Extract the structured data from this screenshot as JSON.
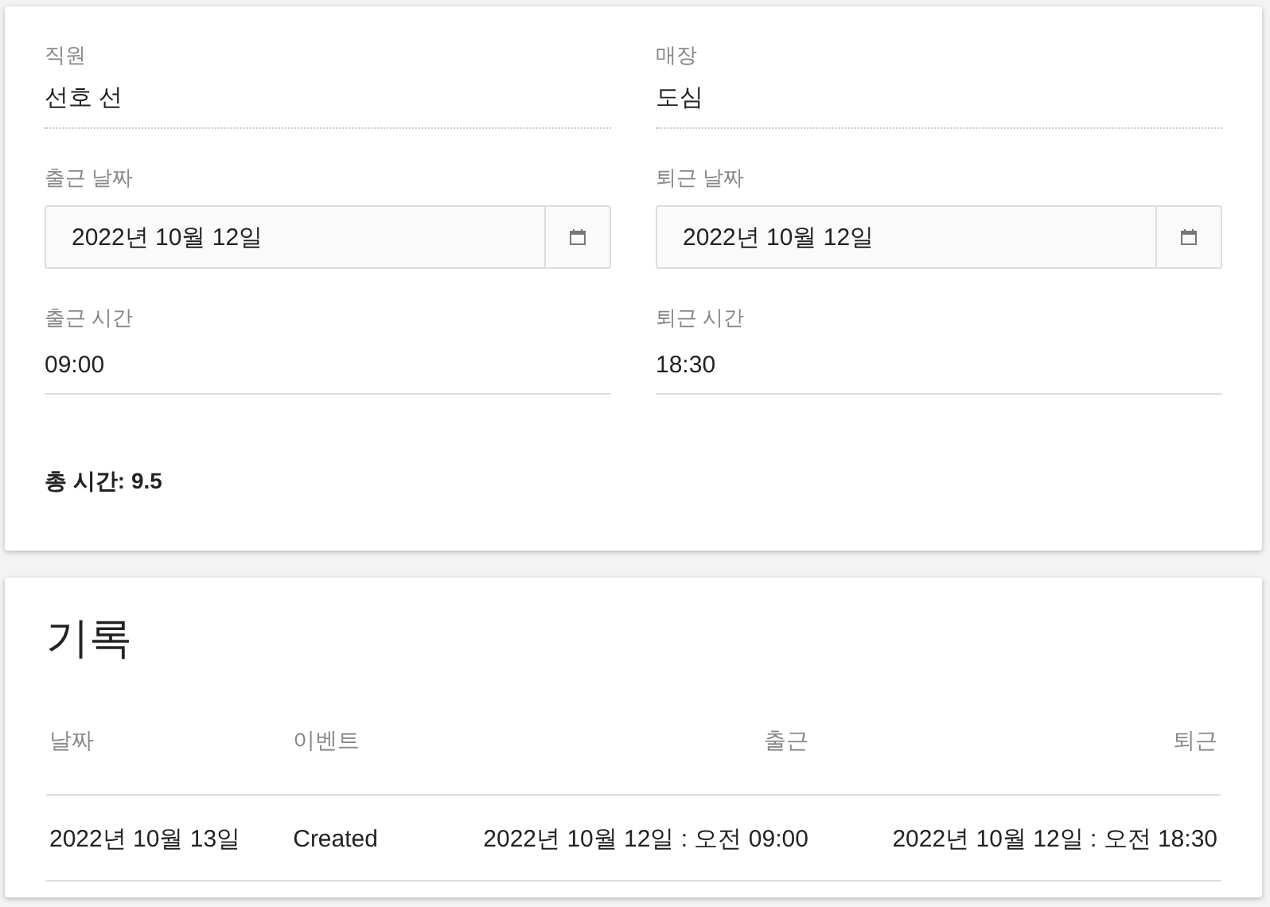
{
  "form": {
    "fields": [
      {
        "kind": "readonly",
        "label": "직원",
        "value": "선호 선"
      },
      {
        "kind": "readonly",
        "label": "매장",
        "value": "도심"
      },
      {
        "kind": "date",
        "label": "출근 날짜",
        "value": "2022년 10월 12일"
      },
      {
        "kind": "date",
        "label": "퇴근 날짜",
        "value": "2022년 10월 12일"
      },
      {
        "kind": "time",
        "label": "출근 시간",
        "value": "09:00"
      },
      {
        "kind": "time",
        "label": "퇴근 시간",
        "value": "18:30"
      }
    ],
    "total": {
      "label": "총 시간:",
      "value": "9.5"
    }
  },
  "history": {
    "title": "기록",
    "columns": [
      "날짜",
      "이벤트",
      "출근",
      "퇴근"
    ],
    "rows": [
      [
        "2022년 10월 13일",
        "Created",
        "2022년 10월 12일 : 오전 09:00",
        "2022년 10월 12일 : 오전 18:30"
      ]
    ]
  }
}
